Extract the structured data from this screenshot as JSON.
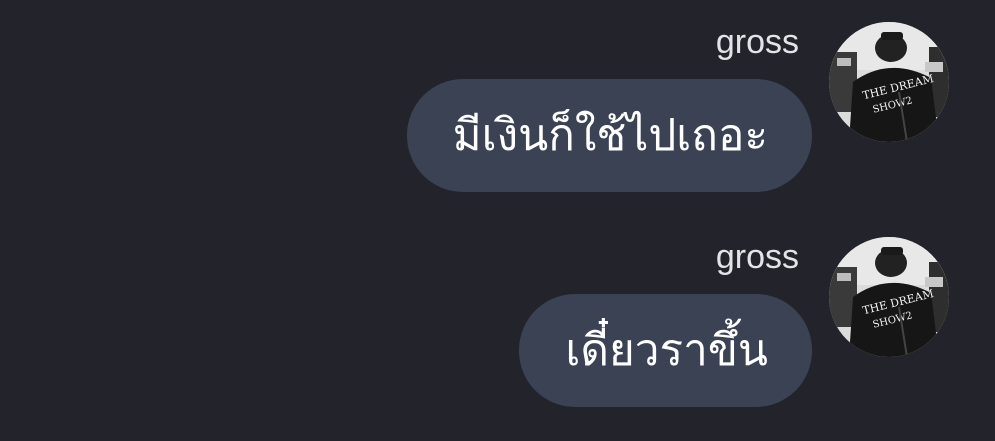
{
  "messages": [
    {
      "sender": "gross",
      "text": "มีเงินก็ใช้ไปเถอะ",
      "avatar_icon": "user-avatar-photo"
    },
    {
      "sender": "gross",
      "text": "เดี๋ยวราขึ้น",
      "avatar_icon": "user-avatar-photo"
    }
  ],
  "colors": {
    "background": "#23242b",
    "bubble": "#3b4253",
    "sender_text": "#e4e4e8",
    "message_text": "#ffffff"
  }
}
